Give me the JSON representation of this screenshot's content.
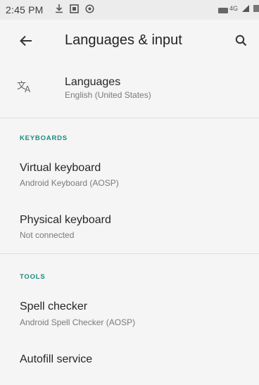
{
  "status_bar": {
    "time": "2:45 PM",
    "network_label": "4G"
  },
  "toolbar": {
    "title": "Languages & input"
  },
  "languages": {
    "title": "Languages",
    "summary": "English (United States)"
  },
  "sections": {
    "keyboards": "KEYBOARDS",
    "tools": "TOOLS"
  },
  "virtual_keyboard": {
    "title": "Virtual keyboard",
    "summary": "Android Keyboard (AOSP)"
  },
  "physical_keyboard": {
    "title": "Physical keyboard",
    "summary": "Not connected"
  },
  "spell_checker": {
    "title": "Spell checker",
    "summary": "Android Spell Checker (AOSP)"
  },
  "autofill": {
    "title": "Autofill service"
  },
  "colors": {
    "accent": "#1a8a7d",
    "background": "#f5f5f5"
  }
}
